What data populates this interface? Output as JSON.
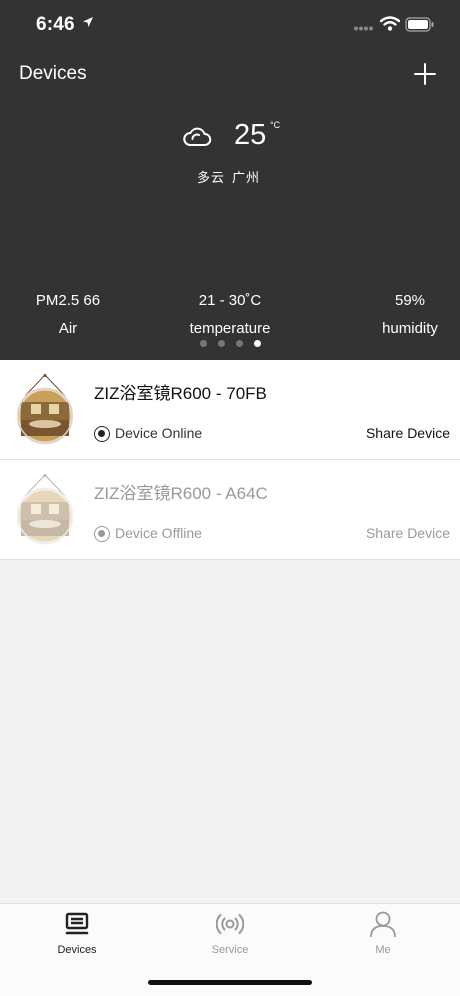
{
  "status_bar": {
    "time": "6:46"
  },
  "header": {
    "title": "Devices",
    "weather": {
      "temperature": "25",
      "unit": "°C",
      "condition": "多云",
      "city": "广州"
    },
    "stats": [
      {
        "value": "PM2.5 66",
        "label": "Air"
      },
      {
        "value": "21 - 30˚C",
        "label": "temperature"
      },
      {
        "value": "59%",
        "label": "humidity"
      }
    ],
    "pager": {
      "count": 4,
      "active_index": 3
    }
  },
  "devices": [
    {
      "name": "ZIZ浴室镜R600 - 70FB",
      "status": "Device Online",
      "share_label": "Share Device"
    },
    {
      "name": "ZIZ浴室镜R600 - A64C",
      "status": "Device Offline",
      "share_label": "Share Device"
    }
  ],
  "tabbar": {
    "tabs": [
      {
        "label": "Devices",
        "icon": "devices-icon",
        "active": true
      },
      {
        "label": "Service",
        "icon": "broadcast-icon",
        "active": false
      },
      {
        "label": "Me",
        "icon": "person-icon",
        "active": false
      }
    ]
  },
  "colors": {
    "header_bg": "#333333",
    "active_dot": "#ffffff",
    "inactive_dot": "#777777",
    "offline_text": "#999999"
  }
}
